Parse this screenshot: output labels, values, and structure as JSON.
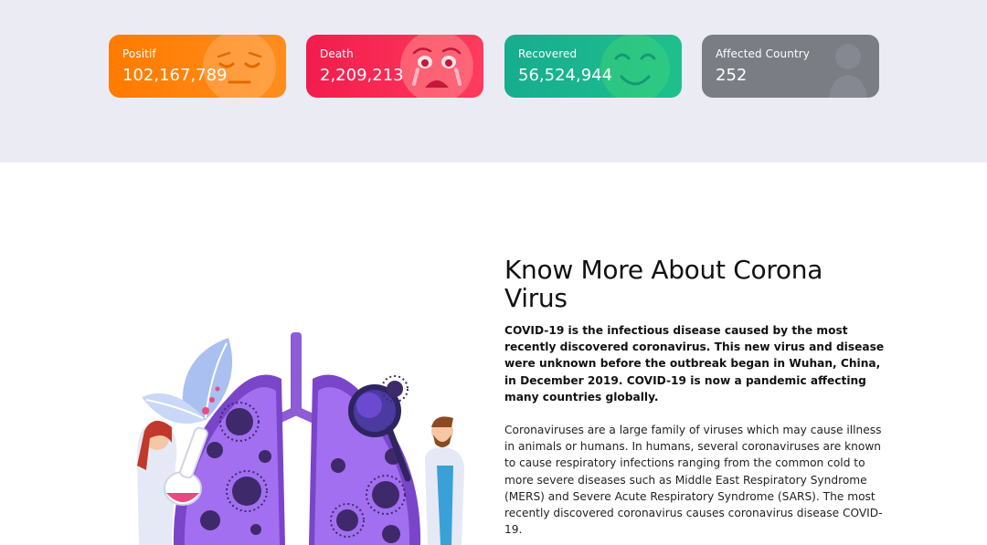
{
  "stats": {
    "positif": {
      "label": "Positif",
      "value": "102,167,789",
      "color": "#ff7b00",
      "icon": "pensive-face-icon"
    },
    "death": {
      "label": "Death",
      "value": "2,209,213",
      "color": "#f21c4c",
      "icon": "crying-face-icon"
    },
    "recovered": {
      "label": "Recovered",
      "value": "56,524,944",
      "color": "#16ad8e",
      "icon": "smiling-face-icon"
    },
    "country": {
      "label": "Affected Country",
      "value": "252",
      "color": "#7a7d84",
      "icon": "person-icon"
    }
  },
  "about": {
    "heading": "Know More About Corona Virus",
    "lead": "COVID-19 is the infectious disease caused by the most recently discovered coronavirus. This new virus and disease were unknown before the outbreak began in Wuhan, China, in December 2019. COVID-19 is now a pandemic affecting many countries globally.",
    "body": "Coronaviruses are a large family of viruses which may cause illness in animals or humans. In humans, several coronaviruses are known to cause respiratory infections ranging from the common cold to more severe diseases such as Middle East Respiratory Syndrome (MERS) and Severe Acute Respiratory Syndrome (SARS). The most recently discovered coronavirus causes coronavirus disease COVID-19."
  }
}
